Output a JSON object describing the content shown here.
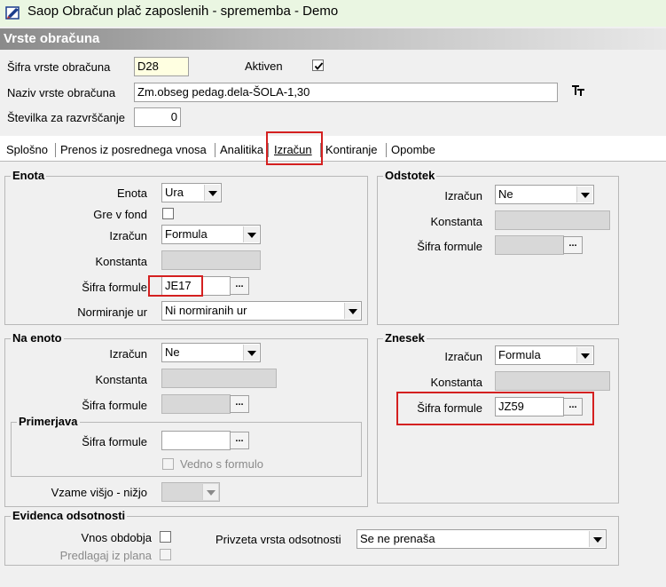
{
  "window": {
    "title": "Saop Obračun plač zaposlenih - sprememba - Demo"
  },
  "header": {
    "title": "Vrste obračuna"
  },
  "top": {
    "sifra_label": "Šifra vrste obračuna",
    "sifra_value": "D28",
    "aktiven_label": "Aktiven",
    "naziv_label": "Naziv vrste obračuna",
    "naziv_value": "Zm.obseg pedag.dela-ŠOLA-1,30",
    "stevilka_label": "Številka  za razvrščanje",
    "stevilka_value": "0"
  },
  "tabs": [
    {
      "label": "Splošno"
    },
    {
      "label": "Prenos iz posrednega vnosa"
    },
    {
      "label": "Analitika"
    },
    {
      "label": "Izračun"
    },
    {
      "label": "Kontiranje"
    },
    {
      "label": "Opombe"
    }
  ],
  "enota": {
    "title": "Enota",
    "enota_label": "Enota",
    "enota_value": "Ura",
    "gre_label": "Gre v fond",
    "izracun_label": "Izračun",
    "izracun_value": "Formula",
    "konstanta_label": "Konstanta",
    "sifra_formule_label": "Šifra formule",
    "sifra_formule_value": "JE17",
    "normiranje_label": "Normiranje ur",
    "normiranje_value": "Ni normiranih ur"
  },
  "odstotek": {
    "title": "Odstotek",
    "izracun_label": "Izračun",
    "izracun_value": "Ne",
    "konstanta_label": "Konstanta",
    "sifra_formule_label": "Šifra formule"
  },
  "na_enoto": {
    "title": "Na enoto",
    "izracun_label": "Izračun",
    "izracun_value": "Ne",
    "konstanta_label": "Konstanta",
    "sifra_formule_label": "Šifra formule",
    "primerjava_title": "Primerjava",
    "primerjava_sifra_label": "Šifra formule",
    "vedno_label": "Vedno s formulo",
    "vzame_label": "Vzame višjo - nižjo"
  },
  "znesek": {
    "title": "Znesek",
    "izracun_label": "Izračun",
    "izracun_value": "Formula",
    "konstanta_label": "Konstanta",
    "sifra_formule_label": "Šifra formule",
    "sifra_formule_value": "JZ59"
  },
  "evidenca": {
    "title": "Evidenca odsotnosti",
    "vnos_label": "Vnos obdobja",
    "predlagaj_label": "Predlagaj iz plana",
    "privzeta_label": "Privzeta vrsta odsotnosti",
    "privzeta_value": "Se ne prenaša"
  },
  "dots": "...",
  "colors": {
    "highlight_box": "#d42020",
    "header_gradient_start": "#8a8a8a"
  }
}
